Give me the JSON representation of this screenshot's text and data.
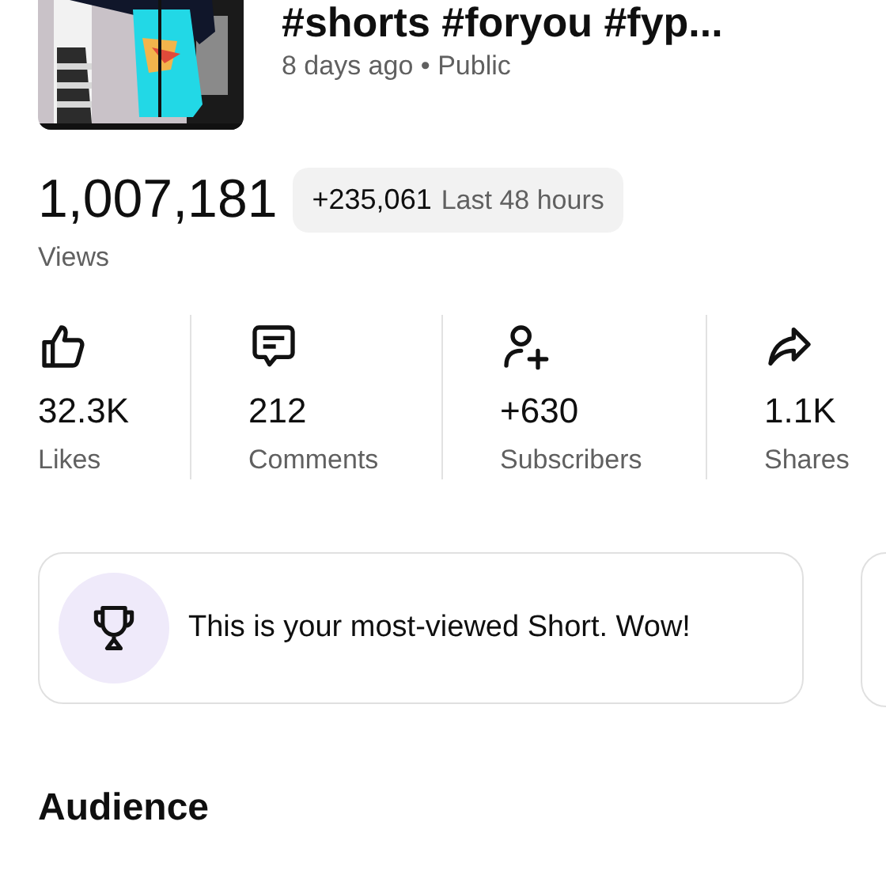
{
  "video": {
    "kind": "picture",
    "title": "#shorts #foryou #fyp...",
    "meta": "8 days ago • Public"
  },
  "views": {
    "count": "1,007,181",
    "label": "Views",
    "recent": {
      "delta": "+235,061",
      "period": "Last 48 hours"
    }
  },
  "stats": [
    {
      "kind": "likes",
      "value": "32.3K",
      "label": "Likes"
    },
    {
      "kind": "comments",
      "value": "212",
      "label": "Comments"
    },
    {
      "kind": "subscribers",
      "value": "+630",
      "label": "Subscribers"
    },
    {
      "kind": "shares",
      "value": "1.1K",
      "label": "Shares"
    }
  ],
  "insight_cards": [
    {
      "kind": "trophy",
      "text": "This is your most-viewed Short. Wow!"
    },
    {
      "kind": "cut"
    }
  ],
  "section": {
    "title": "Audience"
  }
}
